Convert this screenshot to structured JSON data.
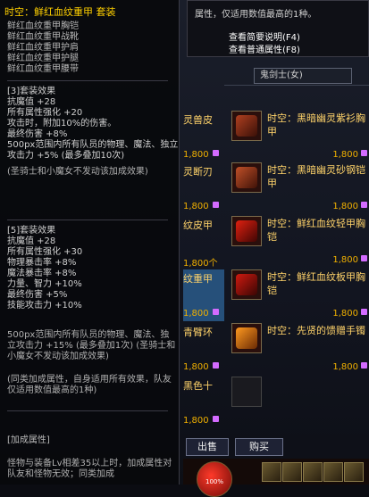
{
  "tooltip": {
    "title": "时空：鲜红血纹重甲  套装",
    "pieces": [
      "鲜红血纹重甲胸铠",
      "鲜红血纹重甲战靴",
      "鲜红血纹重甲护肩",
      "鲜红血纹重甲护腿",
      "鲜红血纹重甲腰带"
    ],
    "set3": {
      "header": "[3]套装效果",
      "lines": [
        "抗魔值 +28",
        "所有属性强化 +20",
        "攻击时，附加10%的伤害。",
        "最终伤害 +8%",
        "500px范围内所有队员的物理、魔法、独立攻击力 +5% (最多叠加10次)",
        "(圣骑士和小魔女不发动该加成效果)"
      ]
    },
    "set5": {
      "header": "[5]套装效果",
      "lines": [
        "抗魔值 +28",
        "所有属性强化 +30",
        "物理暴击率 +8%",
        "魔法暴击率 +8%",
        "力量、智力 +10%",
        "最终伤害 +5%",
        "技能攻击力 +10%"
      ]
    },
    "party_note": "500px范围内所有队员的物理、魔法、独立攻击力 +15% (最多叠加1次) (圣骑士和小魔女不发动该加成效果)",
    "attr_note": "(同类加成属性，自身适用所有效果，队友仅适用数值最高的1种)",
    "bonus_header": "[加成属性]",
    "bonus_text": "怪物与装备Lv相差35以上时，加成属性对队友和怪物无效；同类加成"
  },
  "right_tip": {
    "line1": "属性，仅适用数值最高的1种。",
    "view_desc": "查看简要说明(F4)",
    "view_normal": "查看普通属性(F8)"
  },
  "class_select": "鬼剑士(女)",
  "left_items": [
    {
      "name": "灵兽皮",
      "price": "1,800"
    },
    {
      "name": "灵断刃",
      "price": "1,800"
    },
    {
      "name": "纹皮甲",
      "price": "1,800个"
    },
    {
      "name": "纹重甲",
      "price": "1,800"
    },
    {
      "name": "青臂环",
      "price": "1,800"
    },
    {
      "name": "黑色十",
      "price": "1,800"
    }
  ],
  "right_items": [
    {
      "name": "时空：黑暗幽灵紫衫胸甲",
      "price": "1,800"
    },
    {
      "name": "时空：黑暗幽灵砂钢铠甲",
      "price": "1,800"
    },
    {
      "name": "时空：鲜红血纹轻甲胸铠",
      "price": "1,800"
    },
    {
      "name": "时空：鲜红血纹板甲胸铠",
      "price": "1,800"
    },
    {
      "name": "时空：先贤的馈赠手镯",
      "price": "1,800"
    }
  ],
  "buttons": {
    "sell": "出售",
    "buy": "购买"
  },
  "hud": {
    "hp": "100%"
  },
  "colors": {
    "title": "#ffd000",
    "name": "#ffd36a",
    "price": "#f0b000",
    "coin": "#d36bff"
  }
}
